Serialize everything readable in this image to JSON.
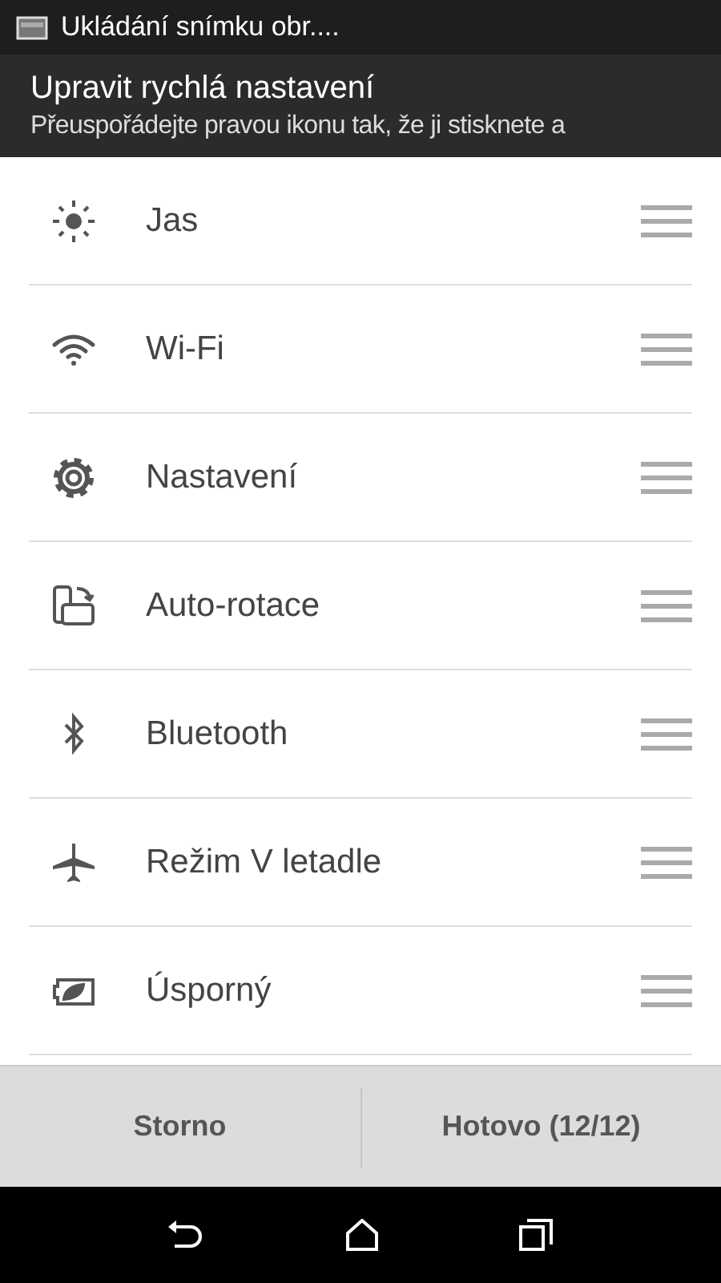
{
  "status_bar": {
    "notification": "Ukládání snímku obr...."
  },
  "header": {
    "title": "Upravit rychlá nastavení",
    "subtitle": "Přeuspořádejte pravou ikonu tak, že ji stisknete a"
  },
  "items": [
    {
      "kind": "brightness",
      "label": "Jas"
    },
    {
      "kind": "wifi",
      "label": "Wi-Fi"
    },
    {
      "kind": "settings",
      "label": "Nastavení"
    },
    {
      "kind": "rotation",
      "label": "Auto-rotace"
    },
    {
      "kind": "bluetooth",
      "label": "Bluetooth"
    },
    {
      "kind": "airplane",
      "label": "Režim V letadle"
    },
    {
      "kind": "battery",
      "label": "Úsporný"
    }
  ],
  "buttons": [
    {
      "label": "Storno"
    },
    {
      "label": "Hotovo  (12/12)"
    }
  ]
}
